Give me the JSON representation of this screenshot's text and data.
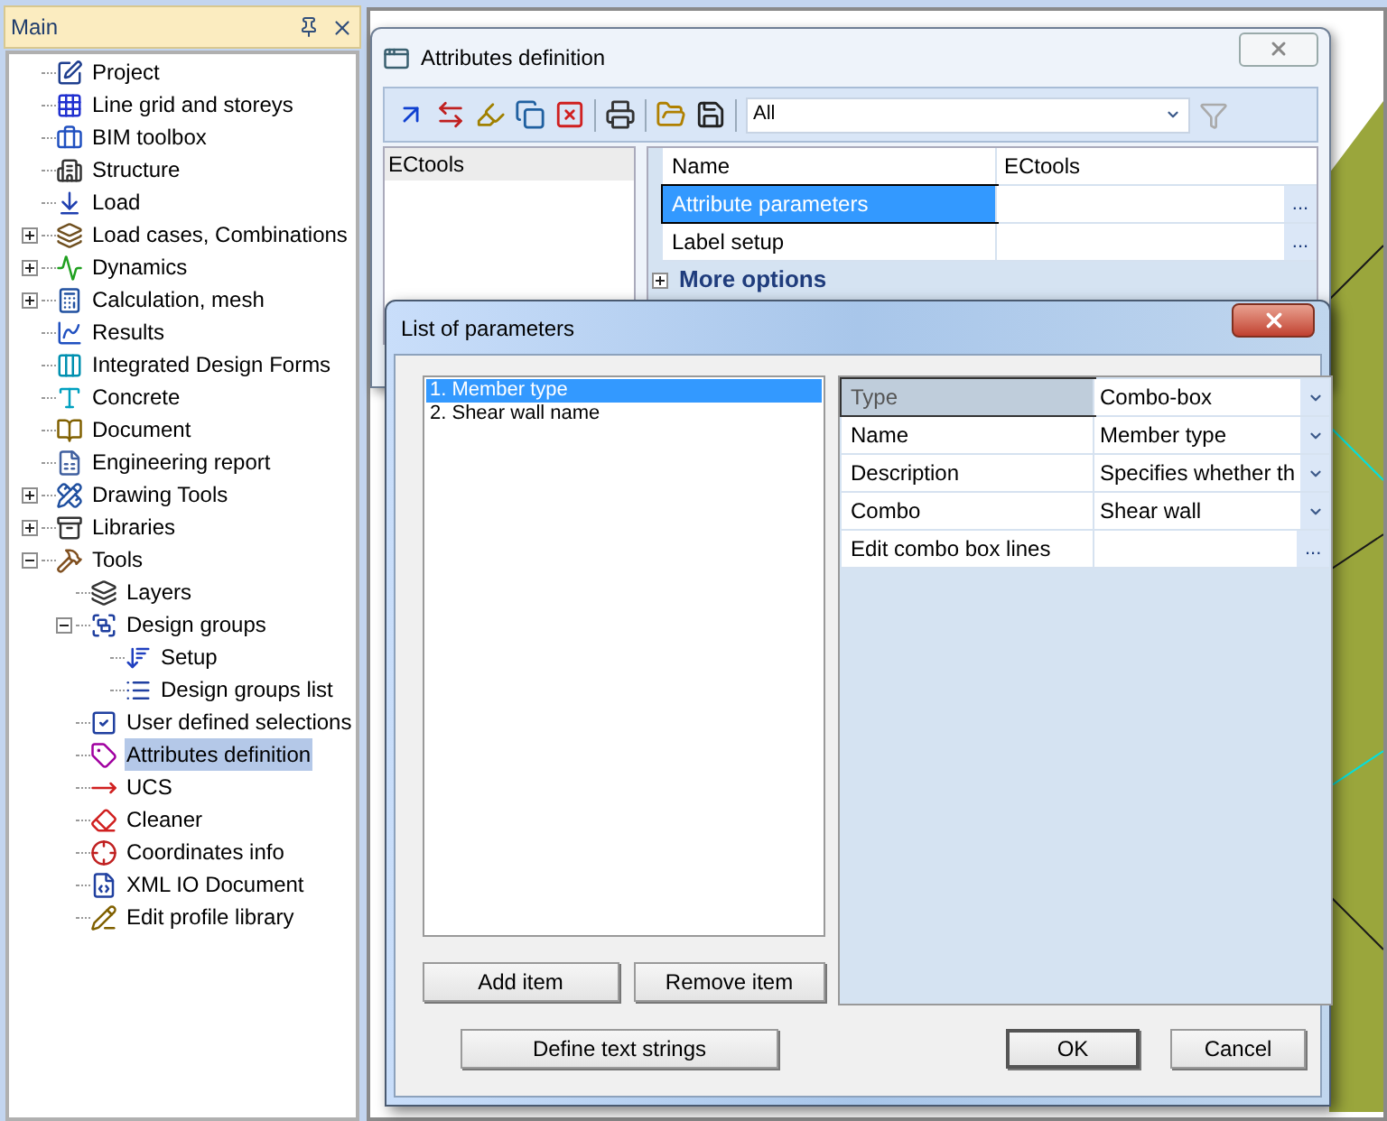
{
  "sidebar": {
    "title": "Main",
    "tree": [
      {
        "label": "Project",
        "selected": false
      },
      {
        "label": "Line grid and storeys",
        "selected": false
      },
      {
        "label": "BIM toolbox",
        "selected": false
      },
      {
        "label": "Structure",
        "selected": false
      },
      {
        "label": "Load",
        "selected": false
      },
      {
        "label": "Load cases, Combinations",
        "selected": false,
        "expanded": false
      },
      {
        "label": "Dynamics",
        "selected": false,
        "expanded": false
      },
      {
        "label": "Calculation, mesh",
        "selected": false,
        "expanded": false
      },
      {
        "label": "Results",
        "selected": false
      },
      {
        "label": "Integrated Design Forms",
        "selected": false
      },
      {
        "label": "Concrete",
        "selected": false
      },
      {
        "label": "Document",
        "selected": false
      },
      {
        "label": "Engineering report",
        "selected": false
      },
      {
        "label": "Drawing Tools",
        "selected": false,
        "expanded": false
      },
      {
        "label": "Libraries",
        "selected": false,
        "expanded": false
      },
      {
        "label": "Tools",
        "selected": false,
        "expanded": true,
        "children": [
          {
            "label": "Layers",
            "selected": false
          },
          {
            "label": "Design groups",
            "selected": false,
            "expanded": true,
            "children": [
              {
                "label": "Setup",
                "selected": false
              },
              {
                "label": "Design groups list",
                "selected": false
              }
            ]
          },
          {
            "label": "User defined selections",
            "selected": false
          },
          {
            "label": "Attributes definition",
            "selected": true
          },
          {
            "label": "UCS",
            "selected": false
          },
          {
            "label": "Cleaner",
            "selected": false
          },
          {
            "label": "Coordinates info",
            "selected": false
          },
          {
            "label": "XML IO Document",
            "selected": false
          },
          {
            "label": "Edit profile library",
            "selected": false
          }
        ]
      }
    ]
  },
  "attributes_window": {
    "title": "Attributes definition",
    "filter": {
      "value": "All"
    },
    "list": [
      {
        "label": "ECtools",
        "selected": true
      }
    ],
    "properties": [
      {
        "name": "Name",
        "value": "ECtools",
        "kind": "text",
        "selected": false
      },
      {
        "name": "Attribute parameters",
        "kind": "dialog",
        "button": "...",
        "selected": true
      },
      {
        "name": "Label setup",
        "kind": "dialog",
        "button": "...",
        "selected": false
      }
    ],
    "more_options": {
      "label": "More options",
      "expanded": false
    }
  },
  "parameters_dialog": {
    "title": "List of parameters",
    "items": [
      {
        "label": "1. Member type",
        "selected": true
      },
      {
        "label": "2. Shear wall name",
        "selected": false
      }
    ],
    "properties": [
      {
        "name": "Type",
        "value": "Combo-box",
        "kind": "dropdown",
        "selected": true
      },
      {
        "name": "Name",
        "value": "Member type",
        "kind": "dropdown",
        "selected": false
      },
      {
        "name": "Description",
        "value": "Specifies whether th",
        "kind": "dropdown",
        "selected": false
      },
      {
        "name": "Combo",
        "value": "Shear wall",
        "kind": "dropdown",
        "selected": false
      },
      {
        "name": "Edit combo box lines",
        "kind": "dialog",
        "button": "...",
        "selected": false
      }
    ],
    "add_button": "Add item",
    "remove_button": "Remove item",
    "define_button": "Define text strings",
    "ok_button": "OK",
    "cancel_button": "Cancel"
  }
}
